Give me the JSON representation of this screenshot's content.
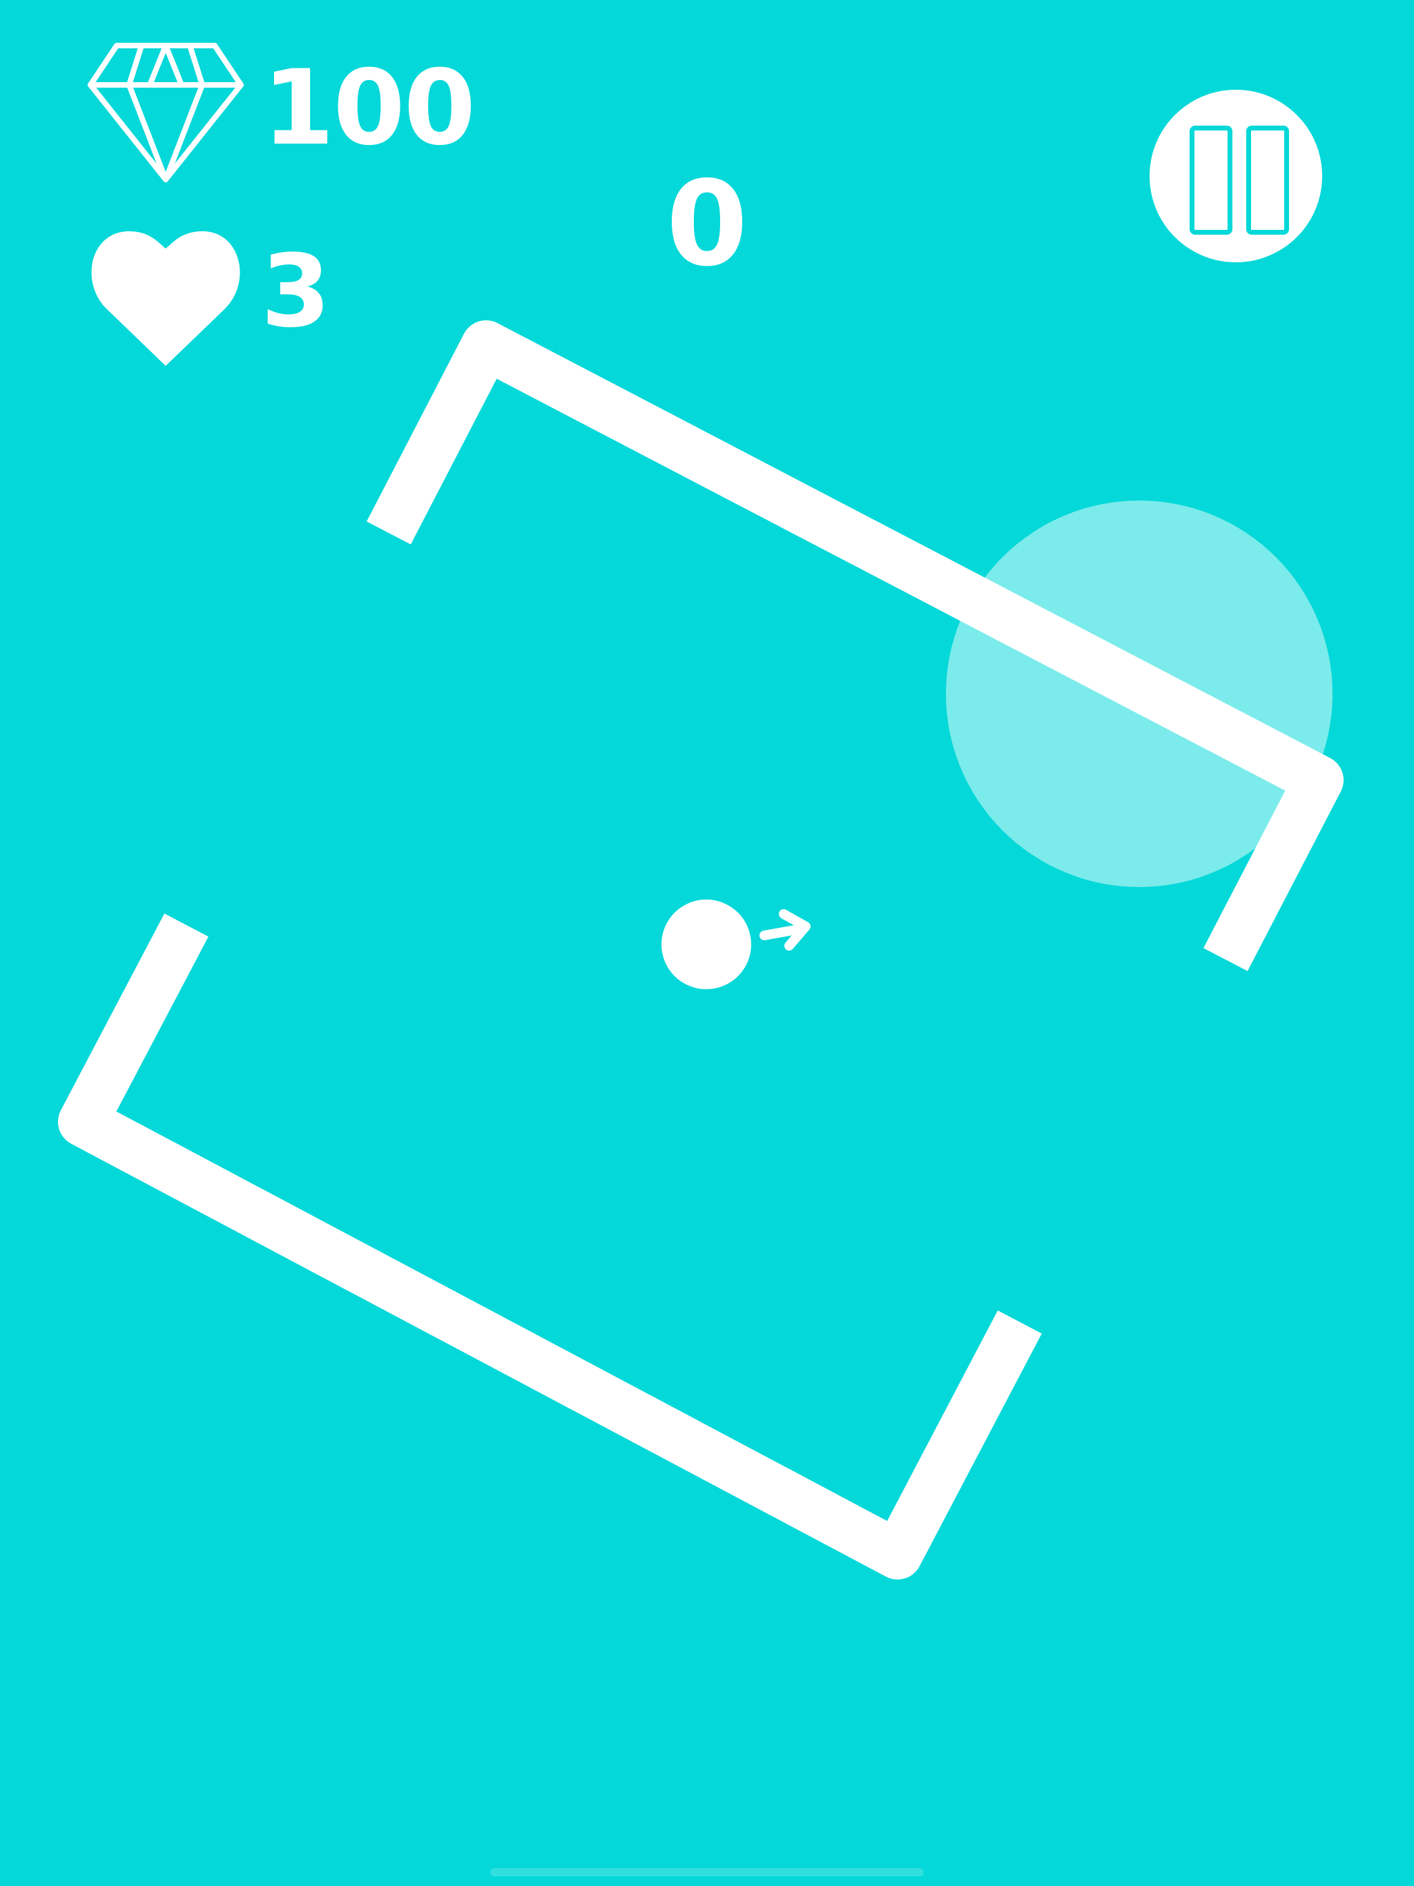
{
  "hud": {
    "gems": "100",
    "lives": "3",
    "score": "0"
  },
  "icons": {
    "gem": "diamond-gem-icon",
    "lives": "heart-icon",
    "pause": "pause-icon",
    "direction": "arrow-right-icon"
  },
  "colors": {
    "background": "#04d8d9",
    "foreground": "#ffffff",
    "target_zone": "rgba(255,255,255,0.48)"
  }
}
